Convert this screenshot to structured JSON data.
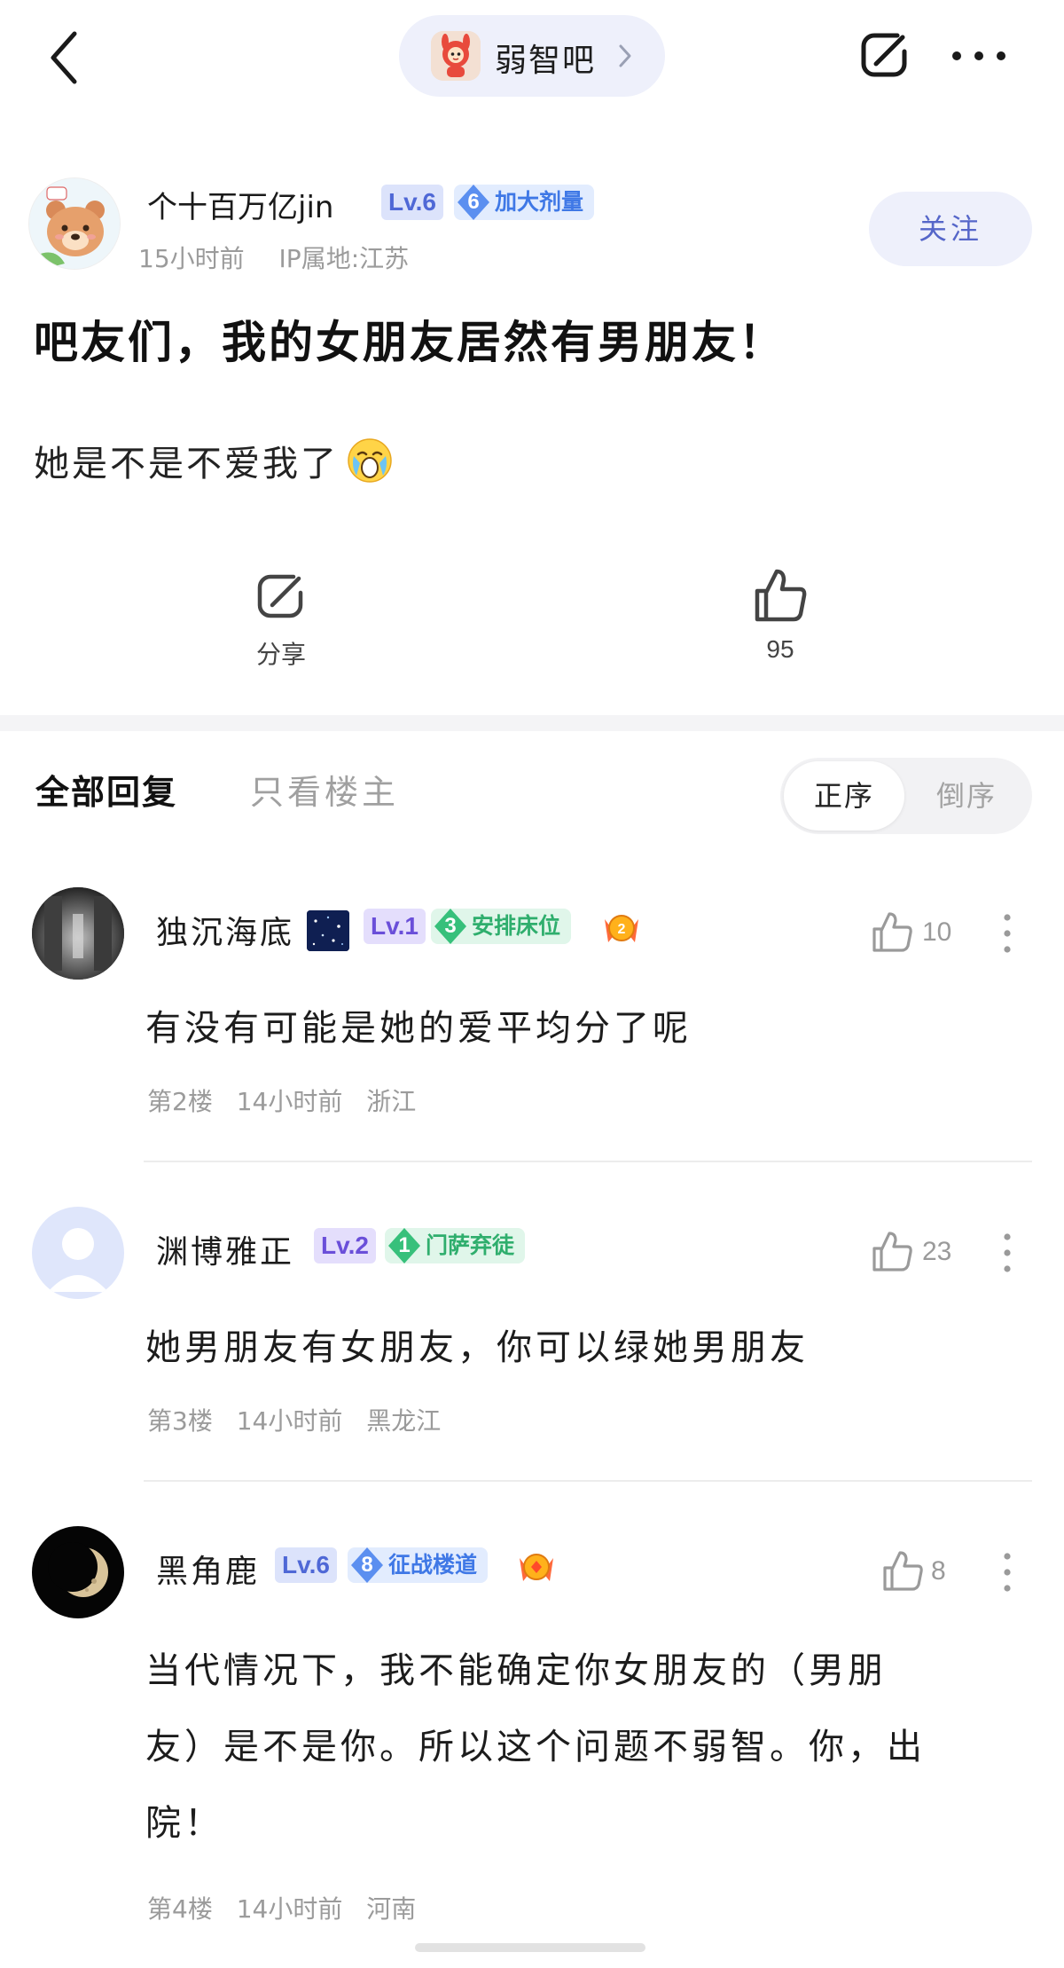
{
  "topbar": {
    "forum_name": "弱智吧",
    "icons": {
      "back": "back-chevron-icon",
      "share": "share-icon",
      "more": "more-dots-icon"
    }
  },
  "post": {
    "author": {
      "name": "个十百万亿jin",
      "level": "Lv.6",
      "title_num": "6",
      "title": "加大剂量",
      "time": "15小时前",
      "ip": "IP属地:江苏",
      "follow_label": "关注"
    },
    "title": "吧友们，我的女朋友居然有男朋友！",
    "body": "她是不是不爱我了",
    "actions": {
      "share_label": "分享",
      "like_count": "95"
    }
  },
  "replies_header": {
    "tab_all": "全部回复",
    "tab_op": "只看楼主",
    "sort_asc": "正序",
    "sort_desc": "倒序"
  },
  "comments": [
    {
      "name": "独沉海底",
      "level": "Lv.1",
      "title_num": "3",
      "title": "安排床位",
      "likes": "10",
      "text": "有没有可能是她的爱平均分了呢",
      "floor": "第2楼",
      "time": "14小时前",
      "location": "浙江",
      "medal_num": "2"
    },
    {
      "name": "渊博雅正",
      "level": "Lv.2",
      "title_num": "1",
      "title": "门萨弃徒",
      "likes": "23",
      "text": "她男朋友有女朋友，你可以绿她男朋友",
      "floor": "第3楼",
      "time": "14小时前",
      "location": "黑龙江"
    },
    {
      "name": "黑角鹿",
      "level": "Lv.6",
      "title_num": "8",
      "title": "征战楼道",
      "likes": "8",
      "text_line1": "当代情况下，我不能确定你女朋友的（男朋",
      "text_line2": "友）是不是你。所以这个问题不弱智。你，出",
      "text_line3": "院！",
      "floor": "第4楼",
      "time": "14小时前",
      "location": "河南"
    }
  ],
  "colors": {
    "accent_blue": "#4f68d6",
    "pill_bg": "#eef0fb",
    "badge_blue": "#3f78e6",
    "badge_green": "#2fae6d",
    "meta_gray": "#9b9b9b"
  }
}
